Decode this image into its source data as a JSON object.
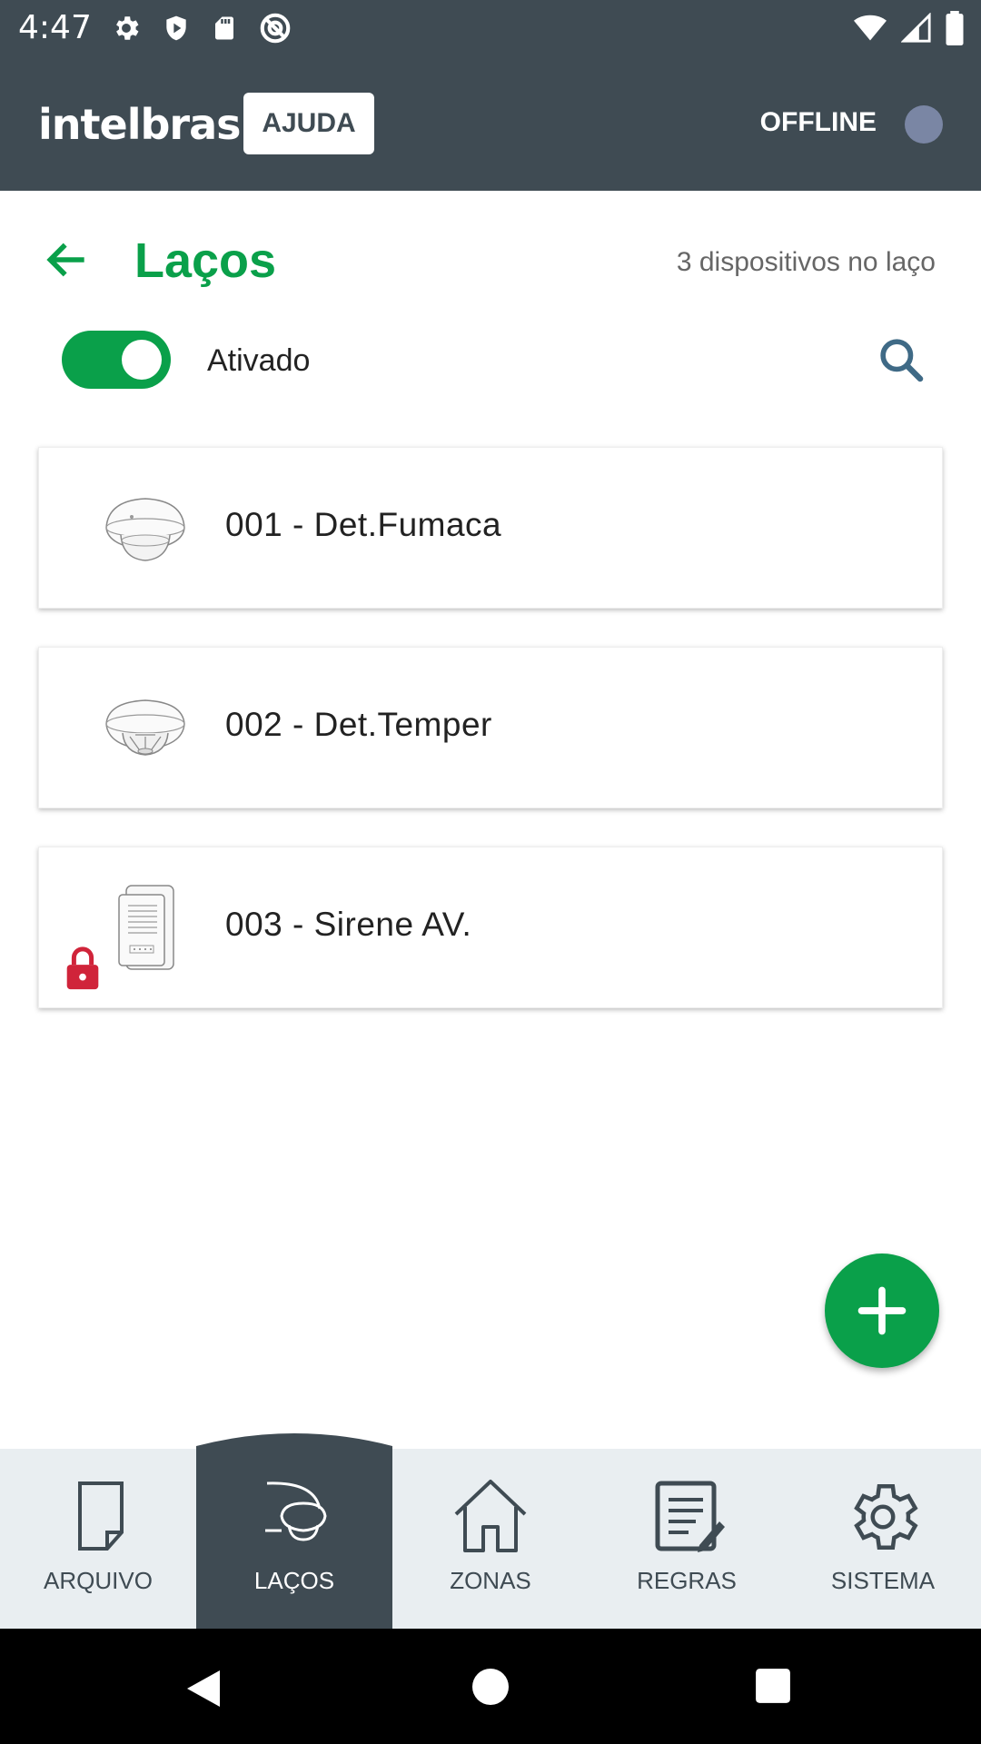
{
  "status_bar": {
    "time": "4:47",
    "left_icons": [
      "gear-icon",
      "shield-icon",
      "sd-card-icon",
      "no-sync-icon"
    ],
    "right_icons": [
      "wifi-icon",
      "signal-icon",
      "battery-icon"
    ]
  },
  "app_bar": {
    "logo_text": "intelbras",
    "help_label": "AJUDA",
    "connection_status": "OFFLINE"
  },
  "header": {
    "title": "Laços",
    "device_count": "3 dispositivos no laço"
  },
  "loop_toggle": {
    "label": "Ativado",
    "enabled": true
  },
  "devices": [
    {
      "label": "001 - Det.Fumaca",
      "icon": "smoke-detector-icon",
      "locked": false
    },
    {
      "label": "002 - Det.Temper",
      "icon": "heat-detector-icon",
      "locked": false
    },
    {
      "label": "003 - Sirene AV.",
      "icon": "siren-icon",
      "locked": true
    }
  ],
  "bottom_nav": {
    "items": [
      {
        "label": "ARQUIVO",
        "icon": "file-icon",
        "active": false
      },
      {
        "label": "LAÇOS",
        "icon": "loop-detector-icon",
        "active": true
      },
      {
        "label": "ZONAS",
        "icon": "house-icon",
        "active": false
      },
      {
        "label": "REGRAS",
        "icon": "rules-icon",
        "active": false
      },
      {
        "label": "SISTEMA",
        "icon": "settings-icon",
        "active": false
      }
    ]
  },
  "colors": {
    "primary_dark": "#3f4b53",
    "accent_green": "#0aa04a",
    "lock_red": "#d0243a",
    "offline_dot": "#7a86a4"
  }
}
